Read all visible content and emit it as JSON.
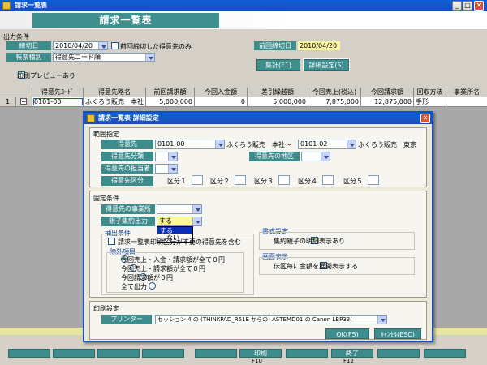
{
  "window": {
    "title": "請求一覧表"
  },
  "header": {
    "title": "請求一覧表"
  },
  "output": {
    "section_label": "出力条件",
    "cutoff_label": "締切日",
    "cutoff_value": "2010/04/20",
    "prev_only_label": "前回締切した得意先のみ",
    "prev_cutoff_label": "前回締切日",
    "prev_cutoff_value": "2010/04/20",
    "form_label": "帳票種別",
    "form_value": "得意先コード順",
    "aggregate_button": "集計(F1)",
    "detail_button": "詳細設定(S)",
    "preview_label": "印刷プレビューあり"
  },
  "table": {
    "columns": [
      "得意先ｺｰﾄﾞ",
      "得意先略名",
      "前回請求額",
      "今回入金額",
      "差引繰越額",
      "今回売上(税込)",
      "今回請求額",
      "回収方法",
      "事業所名"
    ],
    "rows": [
      {
        "num": "1",
        "expand": "+",
        "cells": [
          "0101-00",
          "ふくろう販売　本社",
          "5,000,000",
          "0",
          "5,000,000",
          "7,875,000",
          "12,875,000",
          "手形",
          ""
        ]
      }
    ]
  },
  "footer": {
    "print_label": "印刷",
    "print_key": "F10",
    "exit_label": "終了",
    "exit_key": "F12"
  },
  "dialog": {
    "title": "請求一覧表 詳細設定",
    "range": {
      "section": "範囲指定",
      "customer_label": "得意先",
      "from_code": "0101-00",
      "from_name": "ふくろう販売　本社",
      "tilde": "～",
      "to_code": "0101-02",
      "to_name": "ふくろう販売　東京",
      "class_label": "得意先分類",
      "region_label": "得意先の地区",
      "person_label": "得意先の担当者",
      "division_label": "得意先区分",
      "divisions": [
        "区分１",
        "区分２",
        "区分３",
        "区分４",
        "区分５"
      ]
    },
    "fixed": {
      "section": "固定条件",
      "office_label": "得意先の事業所",
      "parent_label": "親子集約出力",
      "parent_value": "する",
      "parent_options": [
        "する",
        "しない"
      ],
      "extract_title": "抽出条件",
      "exclude_check": "請求一覧表印刷区分が不要の得意先を含む",
      "exclude_title": "除外項目",
      "radios": [
        "今回売上・入金・請求額が全て０円",
        "今回売上・請求額が全て０円",
        "今回請求額が０円",
        "全て出力"
      ],
      "format_title": "書式設定",
      "format_check": "集約親子の明細表示あり",
      "screen_title": "画面表示",
      "screen_check": "伝区毎に金額を展開表示する"
    },
    "print": {
      "section": "印刷設定",
      "printer_label": "プリンター",
      "printer_value": "セッション 4 の (THINKPAD_R51E からの) ASTEMD01 の Canon LBP33("
    },
    "ok_button": "OK(F5)",
    "cancel_button": "ｷｬﾝｾﾙ(ESC)"
  }
}
